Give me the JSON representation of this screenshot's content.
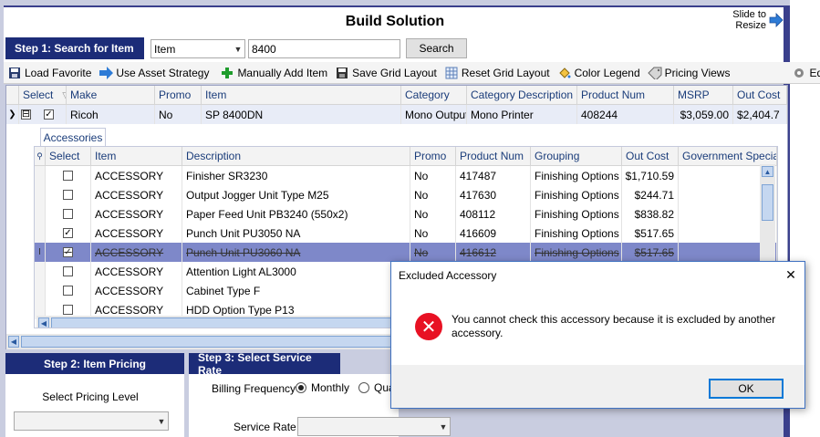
{
  "header": {
    "title": "Build Solution",
    "slide_resize": "Slide to Resize"
  },
  "step1": {
    "label": "Step 1: Search for Item",
    "search_type": "Item",
    "search_value": "8400",
    "search_button": "Search"
  },
  "toolbar": {
    "load_favorite": "Load Favorite",
    "use_asset_strategy": "Use Asset Strategy",
    "manually_add_item": "Manually Add Item",
    "save_grid_layout": "Save Grid Layout",
    "reset_grid_layout": "Reset Grid Layout",
    "color_legend": "Color Legend",
    "pricing_views": "Pricing Views",
    "edit_partial": "Ed"
  },
  "main_grid": {
    "columns": [
      "Select",
      "Make",
      "Promo",
      "Item",
      "Category",
      "Category Description",
      "Product Num",
      "MSRP",
      "Out Cost"
    ],
    "row": {
      "expand": "⊟",
      "make": "Ricoh",
      "promo": "No",
      "item": "SP 8400DN",
      "category": "Mono Output",
      "category_description": "Mono Printer",
      "product_num": "408244",
      "msrp": "$3,059.00",
      "out_cost": "$2,404.7"
    }
  },
  "accessories": {
    "tab_label": "Accessories",
    "columns": [
      "Select",
      "Item",
      "Description",
      "Promo",
      "Product Num",
      "Grouping",
      "Out Cost",
      "Government Special"
    ],
    "rows": [
      {
        "checked": false,
        "item": "ACCESSORY",
        "description": "Finisher SR3230",
        "promo": "No",
        "product_num": "417487",
        "grouping": "Finishing Options",
        "out_cost": "$1,710.59"
      },
      {
        "checked": false,
        "item": "ACCESSORY",
        "description": "Output Jogger Unit Type M25",
        "promo": "No",
        "product_num": "417630",
        "grouping": "Finishing Options",
        "out_cost": "$244.71"
      },
      {
        "checked": false,
        "item": "ACCESSORY",
        "description": "Paper Feed Unit PB3240 (550x2)",
        "promo": "No",
        "product_num": "408112",
        "grouping": "Finishing Options",
        "out_cost": "$838.82"
      },
      {
        "checked": true,
        "item": "ACCESSORY",
        "description": "Punch Unit PU3050 NA",
        "promo": "No",
        "product_num": "416609",
        "grouping": "Finishing Options",
        "out_cost": "$517.65"
      },
      {
        "checked": true,
        "item": "ACCESSORY",
        "description": "Punch Unit PU3060 NA",
        "promo": "No",
        "product_num": "416612",
        "grouping": "Finishing Options",
        "out_cost": "$517.65"
      },
      {
        "checked": false,
        "item": "ACCESSORY",
        "description": "Attention Light AL3000",
        "promo": "",
        "product_num": "",
        "grouping": "",
        "out_cost": ""
      },
      {
        "checked": false,
        "item": "ACCESSORY",
        "description": "Cabinet Type F",
        "promo": "",
        "product_num": "",
        "grouping": "",
        "out_cost": ""
      },
      {
        "checked": false,
        "item": "ACCESSORY",
        "description": "HDD Option Type P13",
        "promo": "",
        "product_num": "",
        "grouping": "",
        "out_cost": ""
      }
    ]
  },
  "step2": {
    "label": "Step 2: Item Pricing",
    "pricing_level_label": "Select Pricing Level",
    "pricing_level_value": ""
  },
  "step3": {
    "label": "Step 3: Select Service Rate",
    "billing_frequency_label": "Billing Frequency",
    "monthly_label": "Monthly",
    "quarterly_label": "Qua",
    "service_rate_label": "Service Rate",
    "service_rate_value": ""
  },
  "dialog": {
    "title": "Excluded Accessory",
    "message": "You cannot check this accessory because it is excluded by another accessory.",
    "ok_label": "OK"
  }
}
